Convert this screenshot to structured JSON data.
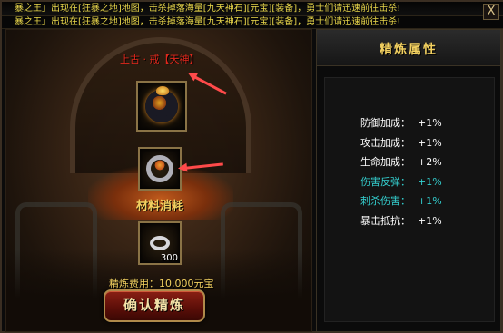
{
  "announcement": {
    "line1": "暴之王」出现在[狂暴之地]地图，击杀掉落海量[九天神石][元宝][装备]，勇士们请迅速前往击杀!",
    "line2": "暴之王」出现在[狂暴之地]地图，击杀掉落海量[九天神石][元宝][装备]，勇士们请迅速前往击杀!"
  },
  "close_label": "X",
  "forge": {
    "target_label": "上古 · 戒【天神】",
    "material_title": "材料消耗",
    "material_count": "300",
    "fee_label": "精炼费用：10,000元宝",
    "confirm_label": "确认精炼"
  },
  "attributes": {
    "title": "精炼属性",
    "items": [
      {
        "name": "防御加成：",
        "value": "+1%",
        "color": "#ffffff"
      },
      {
        "name": "攻击加成：",
        "value": "+1%",
        "color": "#ffffff"
      },
      {
        "name": "生命加成：",
        "value": "+2%",
        "color": "#ffffff"
      },
      {
        "name": "伤害反弹：",
        "value": "+1%",
        "color": "#34d0d0"
      },
      {
        "name": "刺杀伤害：",
        "value": "+1%",
        "color": "#34d0d0"
      },
      {
        "name": "暴击抵抗：",
        "value": "+1%",
        "color": "#ffffff"
      }
    ]
  },
  "colors": {
    "gold_text": "#f2d060",
    "red_text": "#e0281c",
    "cyan_text": "#34d0d0",
    "arrow": "#ff4a4a"
  }
}
